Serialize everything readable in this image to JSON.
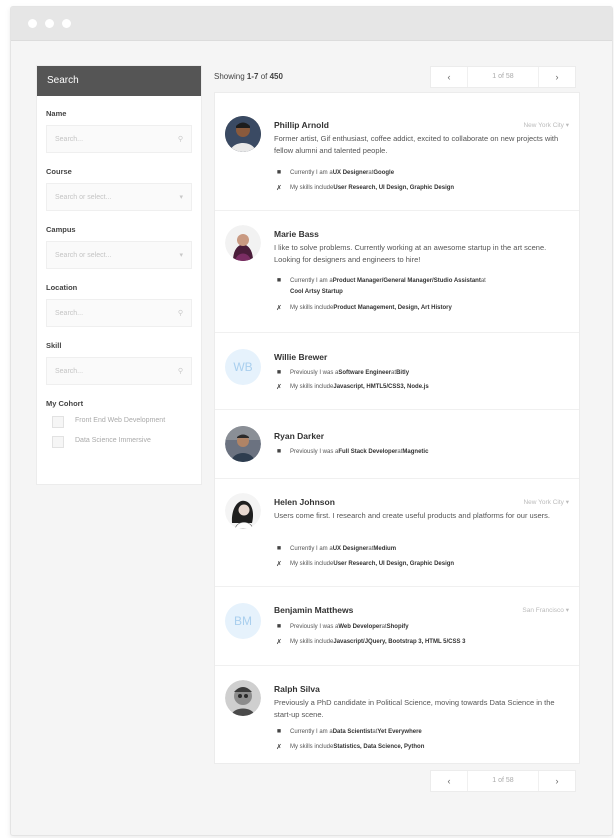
{
  "sidebar": {
    "title": "Search",
    "name_label": "Name",
    "name_placeholder": "Search...",
    "course_label": "Course",
    "course_placeholder": "Search or select...",
    "campus_label": "Campus",
    "campus_placeholder": "Search or select...",
    "location_label": "Location",
    "location_placeholder": "Search...",
    "skill_label": "Skill",
    "skill_placeholder": "Search...",
    "cohort_label": "My Cohort",
    "cohort_options": [
      "Front End Web Development",
      "Data Science Immersive"
    ]
  },
  "results_header": {
    "showing_prefix": "Showing ",
    "showing_range": "1-7",
    "showing_mid": " of ",
    "showing_total": "450"
  },
  "pager": {
    "prev": "‹",
    "next": "›",
    "page_text": "1 of 58"
  },
  "people": [
    {
      "name": "Phillip Arnold",
      "location": "New York City",
      "bio": "Former artist, Gif enthusiast, coffee addict, excited to collaborate on new projects with fellow alumni and talented people.",
      "work_prefix": "Currently I am a ",
      "work_role": "UX Designer",
      "work_mid": " at ",
      "work_company": "Google",
      "skills_prefix": "My skills include ",
      "skills": "User Research, UI Design, Graphic Design"
    },
    {
      "name": "Marie Bass",
      "location": "",
      "bio": "I like to solve problems. Currently working at an awesome startup in the art scene. Looking for designers and engineers to hire!",
      "work_prefix": "Currently I am a ",
      "work_role": "Product Manager/General Manager/Studio Assistant",
      "work_mid": " at ",
      "work_company": "Cool Artsy Startup",
      "skills_prefix": "My skills include ",
      "skills": "Product Management, Design, Art History"
    },
    {
      "name": "Willie Brewer",
      "initials": "WB",
      "work_prefix": "Previously I was a ",
      "work_role": "Software Engineer",
      "work_mid": " at ",
      "work_company": "Bitly",
      "skills_prefix": "My skills include ",
      "skills": "Javascript, HMTL5/CSS3, Node.js"
    },
    {
      "name": "Ryan Darker",
      "work_prefix": "Previously I was a ",
      "work_role": "Full Stack Developer",
      "work_mid": " at ",
      "work_company": "Magnetic"
    },
    {
      "name": "Helen Johnson",
      "location": "New York City",
      "bio": "Users come first. I research and create useful products and platforms for our users.",
      "work_prefix": "Currently I am a ",
      "work_role": "UX Designer",
      "work_mid": " at ",
      "work_company": "Medium",
      "skills_prefix": "My skills include ",
      "skills": "User Research, UI Design, Graphic Design"
    },
    {
      "name": "Benjamin Matthews",
      "initials": "BM",
      "location": "San Francisco",
      "work_prefix": "Previously I was a ",
      "work_role": "Web Developer",
      "work_mid": " at ",
      "work_company": "Shopify",
      "skills_prefix": "My skills include ",
      "skills": "Javascript/JQuery, Bootstrap 3, HTML 5/CSS 3"
    },
    {
      "name": "Ralph Silva",
      "bio": "Previously a PhD candidate in Political Science, moving towards Data Science in the start-up scene.",
      "work_prefix": "Currently I am a ",
      "work_role": "Data Scientist",
      "work_mid": " at ",
      "work_company": "Yet Everywhere",
      "skills_prefix": "My skills include ",
      "skills": "Statistics, Data Science, Python"
    }
  ]
}
